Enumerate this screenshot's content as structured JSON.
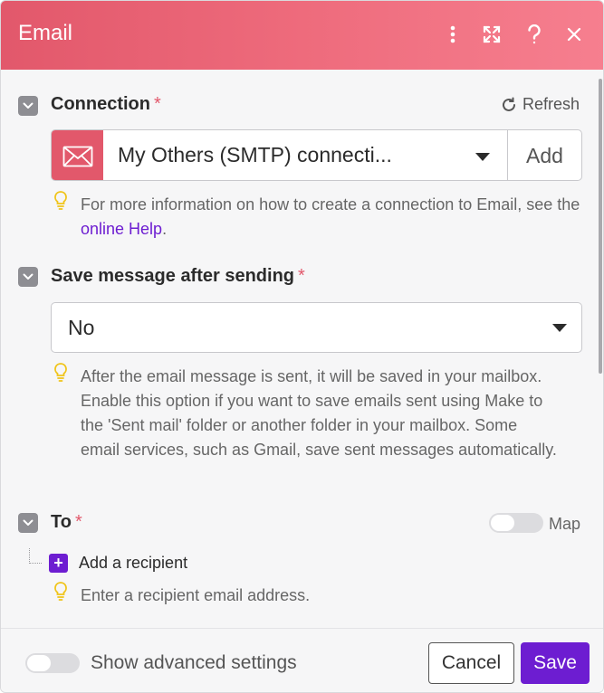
{
  "header": {
    "title": "Email",
    "icons": [
      "more-vertical-icon",
      "expand-icon",
      "help-icon",
      "close-icon"
    ],
    "gradient": [
      "#e2586b",
      "#f67f8f"
    ]
  },
  "connection": {
    "label": "Connection",
    "required_mark": "*",
    "refresh_label": "Refresh",
    "selected": "My Others (SMTP) connecti...",
    "add_label": "Add",
    "hint_text": "For more information on how to create a connection to Email, see the ",
    "hint_link": "online Help",
    "hint_end": "."
  },
  "save_message": {
    "label": "Save message after sending",
    "required_mark": "*",
    "selected": "No",
    "hint": "After the email message is sent, it will be saved in your mailbox. Enable this option if you want to save emails sent using Make to the 'Sent mail' folder or another folder in your mailbox. Some email services, such as Gmail, save sent messages automatically."
  },
  "to": {
    "label": "To",
    "required_mark": "*",
    "map_label": "Map",
    "map_enabled": false,
    "add_recipient": "Add a recipient",
    "hint": "Enter a recipient email address."
  },
  "footer": {
    "advanced_label": "Show advanced settings",
    "advanced_enabled": false,
    "cancel_label": "Cancel",
    "save_label": "Save"
  },
  "colors": {
    "accent": "#6d1dd1",
    "brand": "#e2586b",
    "required": "#e2586b",
    "hint_bulb": "#f0c419"
  }
}
